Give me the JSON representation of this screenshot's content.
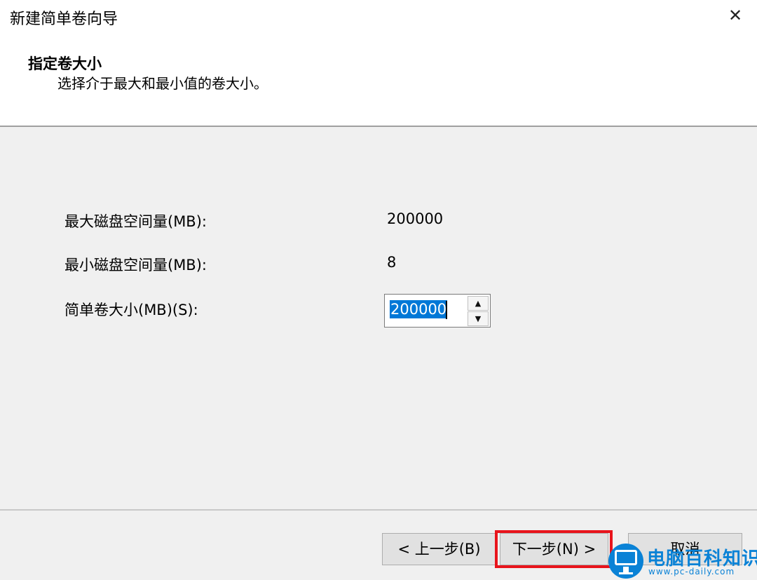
{
  "window": {
    "title": "新建简单卷向导"
  },
  "header": {
    "heading": "指定卷大小",
    "subheading": "选择介于最大和最小值的卷大小。"
  },
  "fields": {
    "max_label": "最大磁盘空间量(MB):",
    "max_value": "200000",
    "min_label": "最小磁盘空间量(MB):",
    "min_value": "8",
    "size_label": "简单卷大小(MB)(S):",
    "size_value": "200000"
  },
  "buttons": {
    "back": "< 上一步(B)",
    "next": "下一步(N) >",
    "cancel": "取消"
  },
  "watermark": {
    "title": "电脑百科知识",
    "url": "www.pc-daily.com"
  },
  "colors": {
    "highlight": "#e8141c",
    "selection": "#0078d7",
    "watermark": "#0a82d6"
  }
}
